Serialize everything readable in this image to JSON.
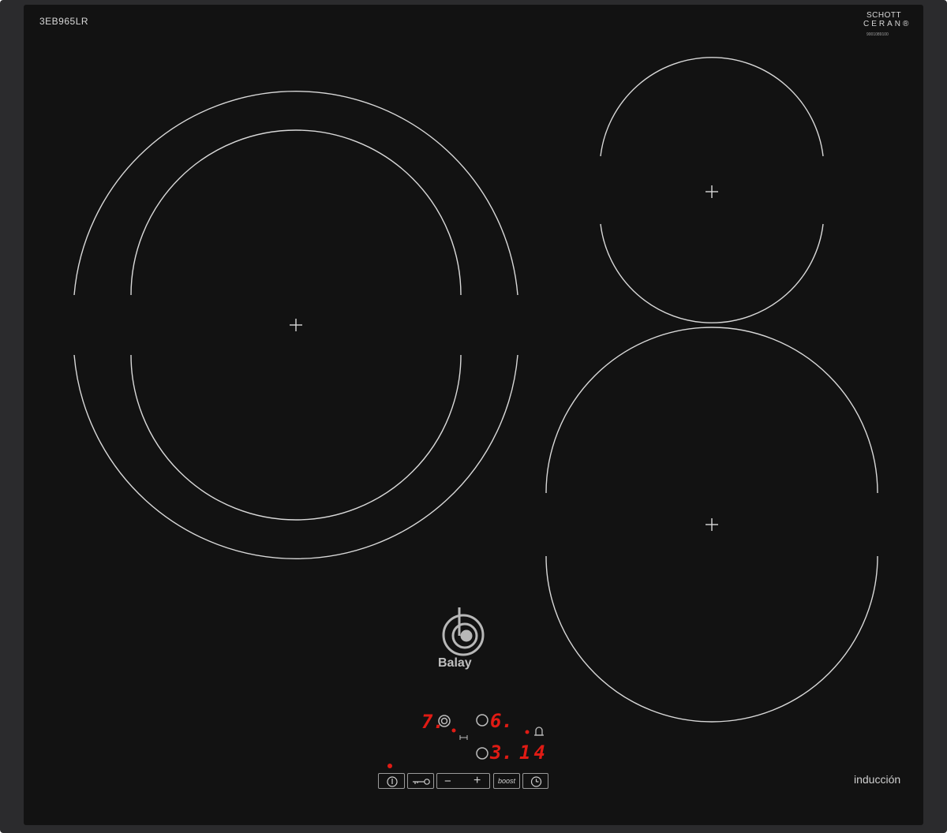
{
  "product": {
    "model": "3EB965LR",
    "glass_brand_line1": "SCHOTT",
    "glass_brand_line2": "CERAN®",
    "serial": "9001089100",
    "brand": "Balay",
    "type_label": "inducción"
  },
  "zones": [
    {
      "name": "dual-zone-left",
      "rings": 2
    },
    {
      "name": "zone-top-right",
      "rings": 1
    },
    {
      "name": "zone-bottom-right",
      "rings": 1
    }
  ],
  "display": {
    "zone_front_left_level": "7.",
    "zone_rear_right_level": "6.",
    "zone_front_right_level": "3.",
    "timer_value": "14"
  },
  "controls": {
    "power_icon": "power-icon",
    "lock_icon": "key-lock-icon",
    "minus_label": "−",
    "plus_label": "+",
    "boost_label": "boost",
    "timer_icon": "clock-icon",
    "alarm_icon": "bell-icon"
  },
  "colors": {
    "glass": "#121212",
    "frame": "#2b2b2d",
    "ring_lines": "#d9d9d9",
    "led_red": "#e01b14"
  }
}
